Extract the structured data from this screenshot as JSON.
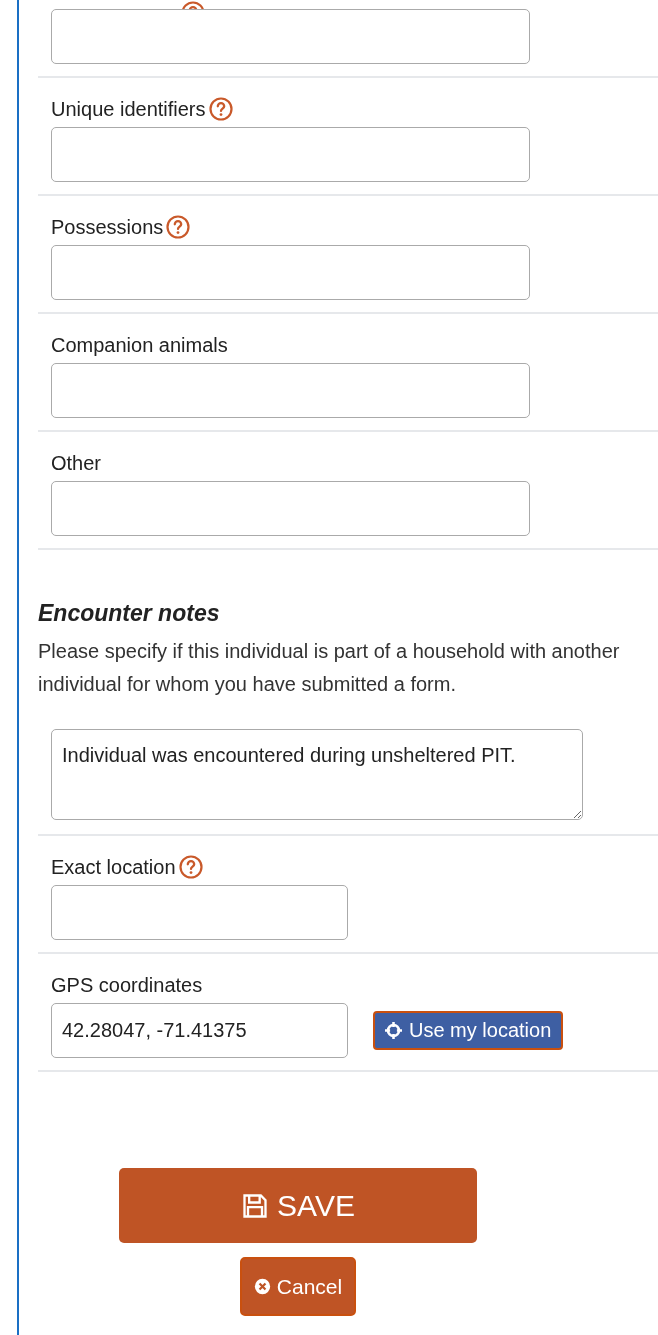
{
  "top_fields": [
    {
      "help": true
    },
    {
      "label": "Unique identifiers",
      "help": true
    },
    {
      "label": "Possessions",
      "help": true
    },
    {
      "label": "Companion animals",
      "help": false
    },
    {
      "label": "Other",
      "help": false
    }
  ],
  "encounter_notes": {
    "heading": "Encounter notes",
    "description": "Please specify if this individual is part of a household with another individual for whom you have submitted a form.",
    "value": "Individual was encountered during unsheltered PIT."
  },
  "exact_location": {
    "label": "Exact location",
    "help": true
  },
  "gps": {
    "label": "GPS coordinates",
    "value": "42.28047, -71.41375",
    "button": "Use my location"
  },
  "save_button": "SAVE",
  "cancel_button": "Cancel"
}
